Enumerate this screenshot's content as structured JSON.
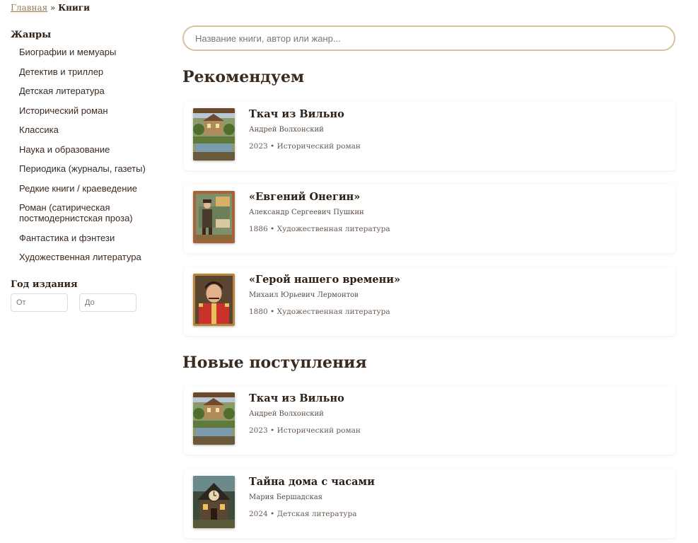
{
  "breadcrumb": {
    "home": "Главная",
    "separator": "»",
    "current": "Книги"
  },
  "sidebar": {
    "genres_heading": "Жанры",
    "genres": [
      "Биографии и мемуары",
      "Детектив и триллер",
      "Детская литература",
      "Исторический роман",
      "Классика",
      "Наука и образование",
      "Периодика (журналы, газеты)",
      "Редкие книги / краеведение",
      "Роман (сатирическая постмодернистская проза)",
      "Фантастика и фэнтези",
      "Художественная литература"
    ],
    "year_heading": "Год издания",
    "year_from_placeholder": "От",
    "year_to_placeholder": "До"
  },
  "search": {
    "placeholder": "Название книги, автор или жанр..."
  },
  "sections": {
    "recommended": {
      "title": "Рекомендуем",
      "books": [
        {
          "title": "Ткач из Вильно",
          "author": "Андрей Волхонский",
          "meta": "2023 • Исторический роман",
          "cover": "house-cover"
        },
        {
          "title": "«Евгений Онегин»",
          "author": "Александр Сергеевич Пушкин",
          "meta": "1886 • Художественная литература",
          "cover": "gentleman-cover"
        },
        {
          "title": "«Герой нашего времени»",
          "author": "Михаил Юрьевич Лермонтов",
          "meta": "1880 • Художественная литература",
          "cover": "officer-portrait-cover"
        }
      ]
    },
    "new_arrivals": {
      "title": "Новые поступления",
      "books": [
        {
          "title": "Ткач из Вильно",
          "author": "Андрей Волхонский",
          "meta": "2023 • Исторический роман",
          "cover": "house-cover"
        },
        {
          "title": "Тайна дома с часами",
          "author": "Мария Бершадская",
          "meta": "2024 • Детская литература",
          "cover": "clock-house-cover"
        }
      ]
    }
  },
  "colors": {
    "accent_border": "#d8c29a",
    "text_dark": "#2d2017",
    "link": "#9a7a52"
  }
}
